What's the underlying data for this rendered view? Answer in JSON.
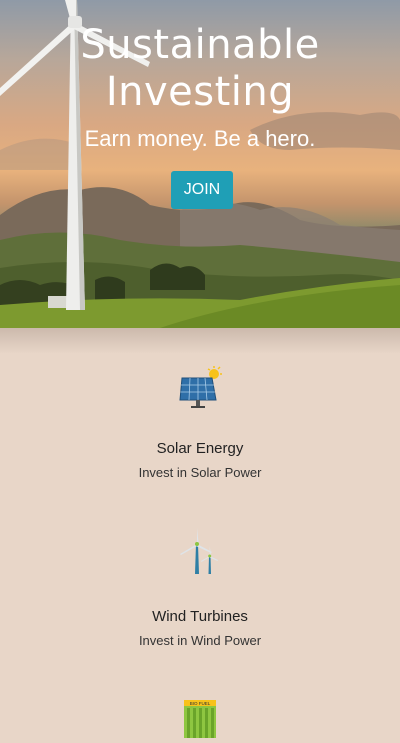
{
  "hero": {
    "title_line1": "Sustainable",
    "title_line2": "Investing",
    "subtitle": "Earn money. Be a hero.",
    "cta_label": "JOIN"
  },
  "features": [
    {
      "icon": "solar-panel-icon",
      "title": "Solar Energy",
      "desc": "Invest in Solar Power"
    },
    {
      "icon": "wind-turbine-icon",
      "title": "Wind Turbines",
      "desc": "Invest in Wind Power"
    },
    {
      "icon": "battery-icon",
      "label": "BIO FUEL"
    }
  ],
  "colors": {
    "background": "#e8d6c8",
    "accent": "#1f9fb6"
  }
}
